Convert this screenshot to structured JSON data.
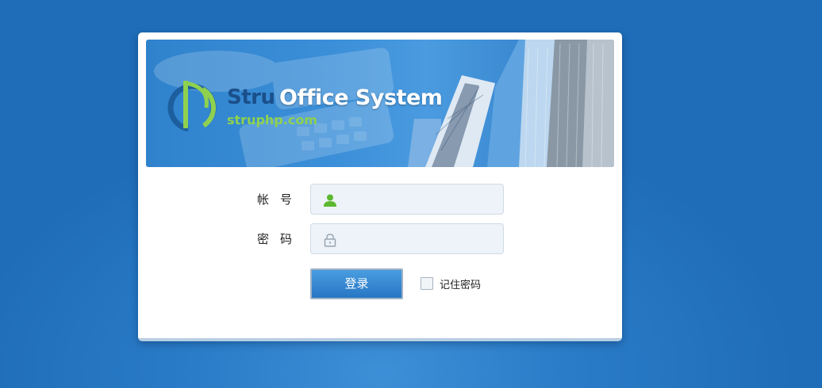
{
  "banner": {
    "brand_prefix": "Stru",
    "brand_name": "Office System",
    "brand_url": "struphp.com"
  },
  "form": {
    "username_label": "帐号",
    "username_value": "",
    "password_label": "密码",
    "password_value": "",
    "login_button": "登录",
    "remember_label": "记住密码",
    "remember_checked": false
  },
  "icons": {
    "username": "user-icon",
    "password": "lock-icon"
  },
  "colors": {
    "background": "#2a7cc8",
    "button": "#2f84d0",
    "user_icon": "#5cb82e",
    "brand_green": "#8fd14f"
  }
}
